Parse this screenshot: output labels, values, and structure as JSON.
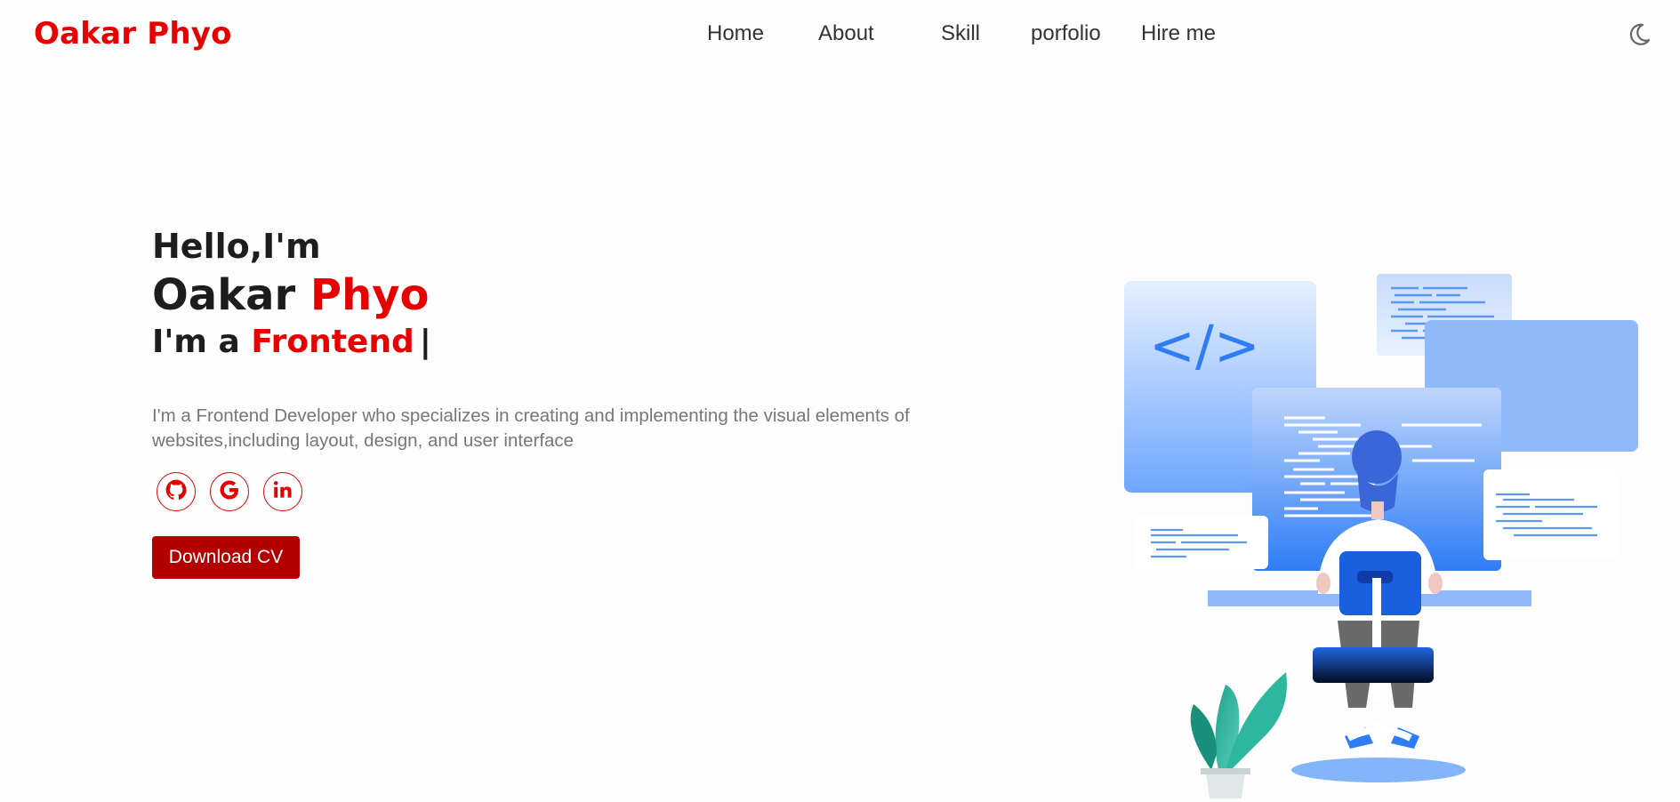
{
  "brand": {
    "name": "Oakar Phyo",
    "color": "#e60000"
  },
  "nav": {
    "links": [
      "Home",
      "About",
      "Skill",
      "porfolio",
      "Hire me"
    ],
    "theme_icon": "moon-icon"
  },
  "hero": {
    "greeting": "Hello,I'm",
    "first_name": "Oakar",
    "last_name": "Phyo",
    "role_prefix": "I'm a",
    "role_word": "Frontend",
    "cursor": "|",
    "description": "I'm a Frontend Developer who specializes in creating and implementing the visual elements of websites,including layout, design, and user interface",
    "socials": [
      {
        "icon": "github-icon"
      },
      {
        "icon": "google-icon"
      },
      {
        "icon": "linkedin-icon"
      }
    ],
    "cta_label": "Download CV"
  },
  "colors": {
    "accent": "#e60000",
    "button": "#b30000",
    "text": "#1d1d1d",
    "muted": "#777777",
    "illustration_blue": "#2f7df6"
  }
}
